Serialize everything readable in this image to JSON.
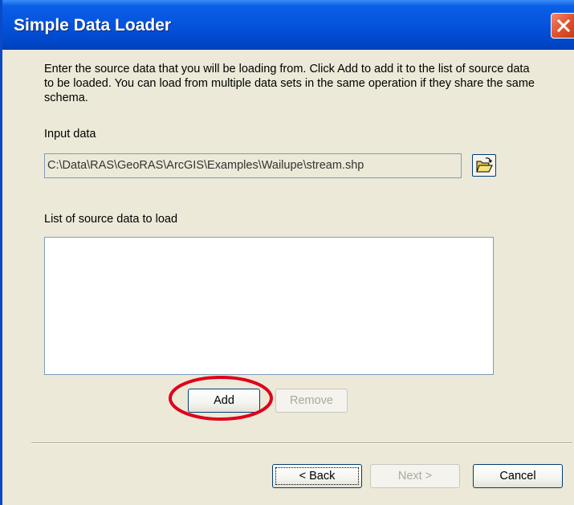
{
  "window": {
    "title": "Simple Data Loader"
  },
  "instructions": "Enter the source data that you will be loading from. Click Add to add it to the list of source data to be loaded. You can load from multiple data sets in the same operation if they share the same schema.",
  "input_data": {
    "label": "Input data",
    "value": "C:\\Data\\RAS\\GeoRAS\\ArcGIS\\Examples\\Wailupe\\stream.shp",
    "browse_icon": "open-folder-icon"
  },
  "source_list": {
    "label": "List of source data to load",
    "items": []
  },
  "buttons": {
    "add": "Add",
    "remove": "Remove",
    "back": "< Back",
    "next": "Next >",
    "cancel": "Cancel"
  },
  "colors": {
    "titlebar": "#0553dc",
    "dialog_bg": "#ece9d8",
    "annotation_circle": "#e0001a"
  }
}
